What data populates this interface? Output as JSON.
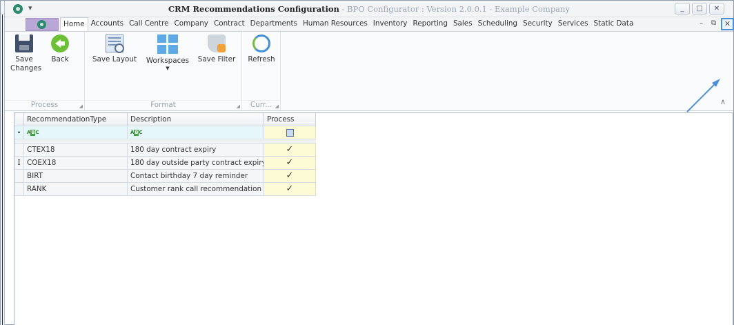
{
  "window": {
    "title_main": "CRM Recommendations Configuration",
    "title_sub": " - BPO Configurator : Version 2.0.0.1 - Example Company",
    "qat_glyph": "▾",
    "controls": {
      "minimize": "_",
      "maximize": "□",
      "close": "✕"
    }
  },
  "mdi_controls": {
    "minimize": "–",
    "restore": "⧉",
    "close": "✕"
  },
  "tabs": [
    {
      "label": "Home",
      "active": true
    },
    {
      "label": "Accounts"
    },
    {
      "label": "Call Centre"
    },
    {
      "label": "Company"
    },
    {
      "label": "Contract"
    },
    {
      "label": "Departments"
    },
    {
      "label": "Human Resources"
    },
    {
      "label": "Inventory"
    },
    {
      "label": "Reporting"
    },
    {
      "label": "Sales"
    },
    {
      "label": "Scheduling"
    },
    {
      "label": "Security"
    },
    {
      "label": "Services"
    },
    {
      "label": "Static Data"
    }
  ],
  "ribbon": {
    "groups": [
      {
        "label": "Process",
        "buttons": [
          {
            "label": "Save Changes",
            "icon": "save-icon"
          },
          {
            "label": "Back",
            "icon": "back-icon"
          }
        ]
      },
      {
        "label": "Format",
        "buttons": [
          {
            "label": "Save Layout",
            "icon": "save-layout-icon"
          },
          {
            "label": "Workspaces",
            "icon": "workspaces-icon"
          },
          {
            "label": "Save Filter",
            "icon": "save-filter-icon"
          }
        ]
      },
      {
        "label": "Curr...",
        "buttons": [
          {
            "label": "Refresh",
            "icon": "refresh-icon"
          }
        ]
      }
    ],
    "save_changes_line1": "Save",
    "save_changes_line2": "Changes",
    "collapse_glyph": "∧"
  },
  "grid": {
    "columns": [
      "RecommendationType",
      "Description",
      "Process"
    ],
    "filter_abc": "A",
    "filter_abc_mid": "B",
    "filter_abc_end": "C",
    "rows": [
      {
        "type": "CTEX18",
        "description": "180 day contract expiry",
        "process": "✓"
      },
      {
        "type": "COEX18",
        "description": "180 day outside party contract expiry",
        "process": "✓"
      },
      {
        "type": "BIRT",
        "description": "Contact birthday 7 day reminder",
        "process": "✓"
      },
      {
        "type": "RANK",
        "description": "Customer rank call recommendation",
        "process": "✓"
      }
    ],
    "pin_glyph": "•",
    "cursor_glyph": "I"
  },
  "colors": {
    "accent_blue": "#4a90d9",
    "process_cell": "#fdfbd6",
    "filter_row": "#e5f7fb"
  }
}
